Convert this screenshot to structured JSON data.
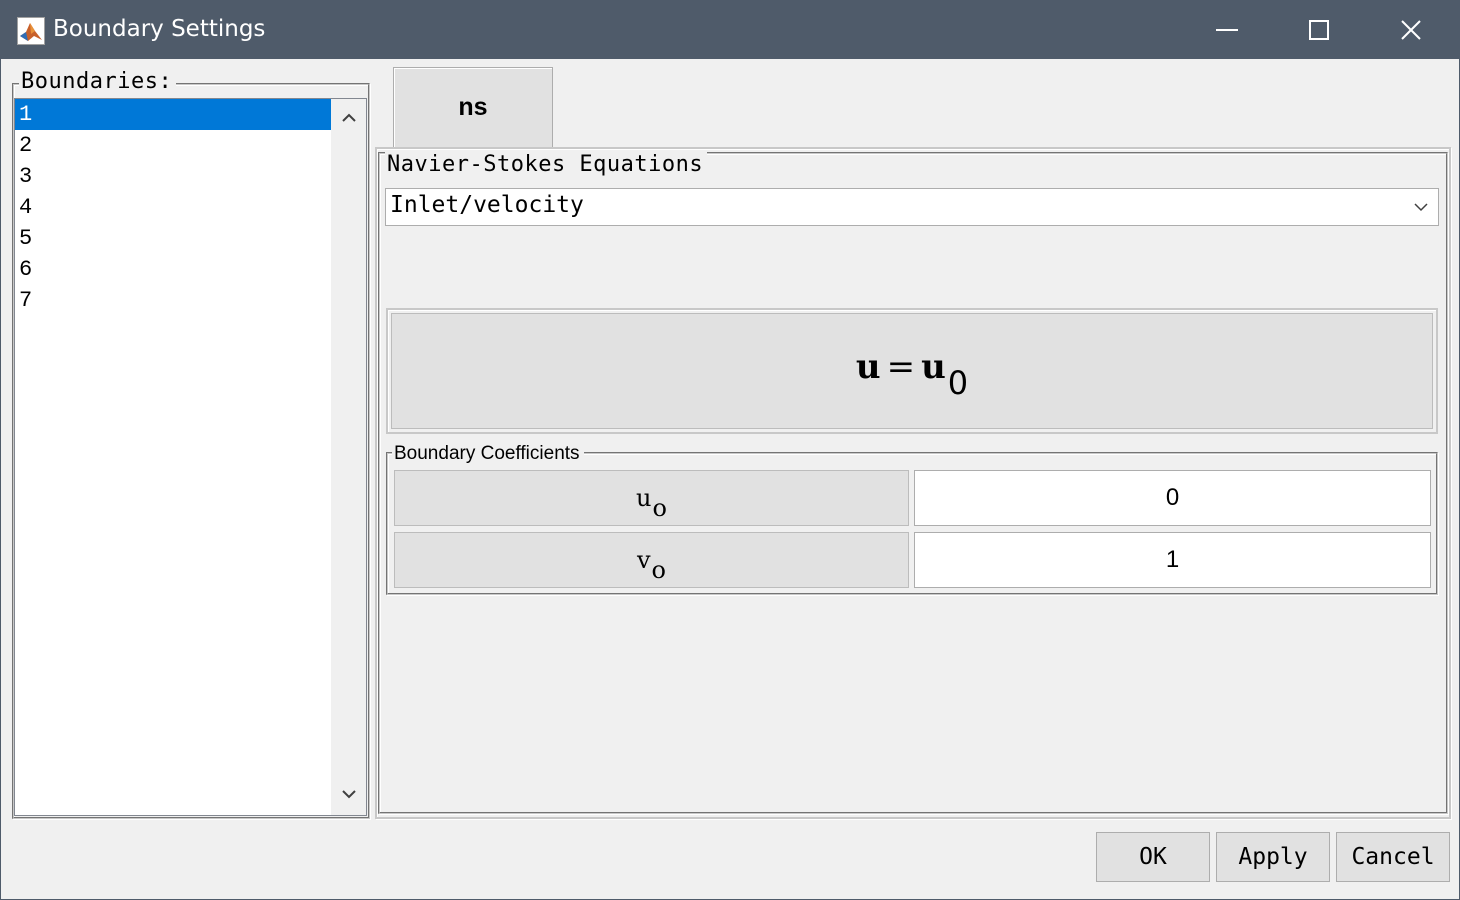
{
  "window": {
    "title": "Boundary Settings",
    "icon": "matlab-icon",
    "controls": [
      "minimize-icon",
      "maximize-icon",
      "close-icon"
    ]
  },
  "boundaries": {
    "label": "Boundaries:",
    "items": [
      "1",
      "2",
      "3",
      "4",
      "5",
      "6",
      "7"
    ],
    "selected": "1"
  },
  "tab": {
    "label": "ns"
  },
  "navier_stokes": {
    "group_label": "Navier-Stokes Equations",
    "condition_type": "Inlet/velocity",
    "equation": {
      "lhs": "u",
      "sign": "=",
      "rhs": "u",
      "rhs_subscript": "0"
    }
  },
  "coefficients": {
    "group_label": "Boundary Coefficients",
    "rows": [
      {
        "symbol": "u",
        "subscript": "o",
        "value": "0"
      },
      {
        "symbol": "v",
        "subscript": "o",
        "value": "1"
      }
    ]
  },
  "buttons": {
    "ok": "OK",
    "apply": "Apply",
    "cancel": "Cancel"
  },
  "colors": {
    "titlebar": "#4f5b6a",
    "selection": "#0078d7",
    "button_face": "#e1e1e1"
  }
}
